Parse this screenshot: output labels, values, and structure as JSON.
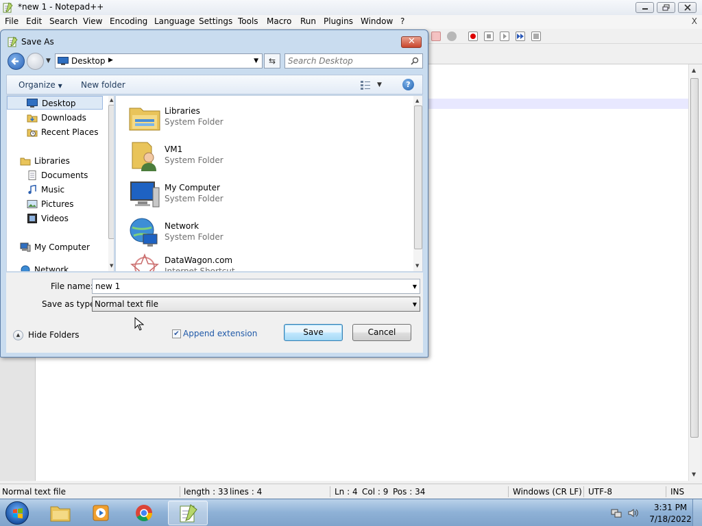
{
  "npp": {
    "title": "*new 1 - Notepad++",
    "menu": [
      "File",
      "Edit",
      "Search",
      "View",
      "Encoding",
      "Language",
      "Settings",
      "Tools",
      "Macro",
      "Run",
      "Plugins",
      "Window",
      "?"
    ],
    "menu_close": "X",
    "status": {
      "type": "Normal text file",
      "length": "length : 33",
      "lines": "lines : 4",
      "ln": "Ln : 4",
      "col": "Col : 9",
      "pos": "Pos : 34",
      "eol": "Windows (CR LF)",
      "encoding": "UTF-8",
      "mode": "INS"
    }
  },
  "dialog": {
    "title": "Save As",
    "address": "Desktop",
    "search_placeholder": "Search Desktop",
    "organize": "Organize",
    "new_folder": "New folder",
    "nav": [
      {
        "label": "Desktop",
        "icon": "desktop-icon",
        "selected": true
      },
      {
        "label": "Downloads",
        "icon": "downloads-icon"
      },
      {
        "label": "Recent Places",
        "icon": "recent-places-icon"
      },
      {
        "label": "Libraries",
        "icon": "libraries-icon"
      },
      {
        "label": "Documents",
        "icon": "documents-icon"
      },
      {
        "label": "Music",
        "icon": "music-icon"
      },
      {
        "label": "Pictures",
        "icon": "pictures-icon"
      },
      {
        "label": "Videos",
        "icon": "videos-icon"
      },
      {
        "label": "My Computer",
        "icon": "computer-icon"
      },
      {
        "label": "Network",
        "icon": "network-icon"
      }
    ],
    "files": [
      {
        "name": "Libraries",
        "type": "System Folder",
        "icon": "libraries-folder-icon"
      },
      {
        "name": "VM1",
        "type": "System Folder",
        "icon": "user-folder-icon"
      },
      {
        "name": "My Computer",
        "type": "System Folder",
        "icon": "computer-icon"
      },
      {
        "name": "Network",
        "type": "System Folder",
        "icon": "network-icon"
      },
      {
        "name": "DataWagon.com",
        "type": "Internet Shortcut",
        "icon": "internet-shortcut-icon"
      }
    ],
    "file_name_label": "File name:",
    "file_name_value": "new 1",
    "save_type_label": "Save as type:",
    "save_type_value": "Normal text file",
    "hide_folders": "Hide Folders",
    "append_extension": "Append extension",
    "append_extension_checked": true,
    "save": "Save",
    "cancel": "Cancel"
  },
  "taskbar": {
    "time": "3:31 PM",
    "date": "7/18/2022"
  }
}
